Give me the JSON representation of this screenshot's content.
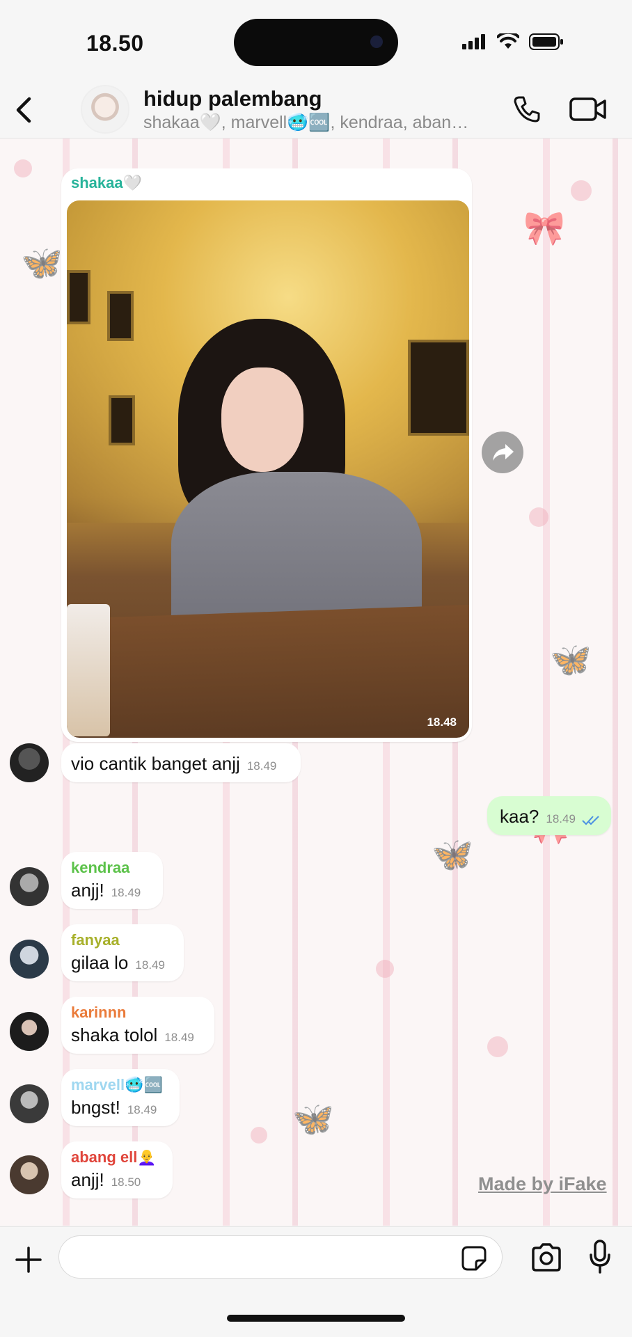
{
  "status_bar": {
    "time": "18.50"
  },
  "header": {
    "back_icon": "chevron-left-icon",
    "title": "hidup palembang",
    "subtitle": "shakaa🤍, marvell🥶🆒, kendraa, aban…",
    "call_icon": "phone-icon",
    "video_icon": "video-camera-icon"
  },
  "messages": {
    "image_message": {
      "sender": "shakaa🤍",
      "sender_color": "#27b39a",
      "time": "18.48"
    },
    "m1": {
      "text": "vio cantik banget anjj",
      "time": "18.49"
    },
    "outgoing": {
      "text": "kaa?",
      "time": "18.49",
      "status_icon": "double-check-icon",
      "bubble_color": "#d8fdd2"
    },
    "m2": {
      "sender": "kendraa",
      "sender_color": "#5cc24a",
      "text": "anjj!",
      "time": "18.49"
    },
    "m3": {
      "sender": "fanyaa",
      "sender_color": "#a7b02a",
      "text": "gilaa lo",
      "time": "18.49"
    },
    "m4": {
      "sender": "karinnn",
      "sender_color": "#ea7b3a",
      "text": "shaka tolol",
      "time": "18.49"
    },
    "m5": {
      "sender": "marvell🥶🆒",
      "sender_color": "#9fd7f0",
      "text": "bngst!",
      "time": "18.49"
    },
    "m6": {
      "sender": "abang ell👩‍🦲",
      "sender_color": "#e0453b",
      "text": "anjj!",
      "time": "18.50"
    }
  },
  "watermark": "Made by iFake",
  "input_bar": {
    "placeholder": "",
    "plus_icon": "plus-icon",
    "sticker_icon": "sticker-icon",
    "camera_icon": "camera-icon",
    "mic_icon": "microphone-icon"
  }
}
